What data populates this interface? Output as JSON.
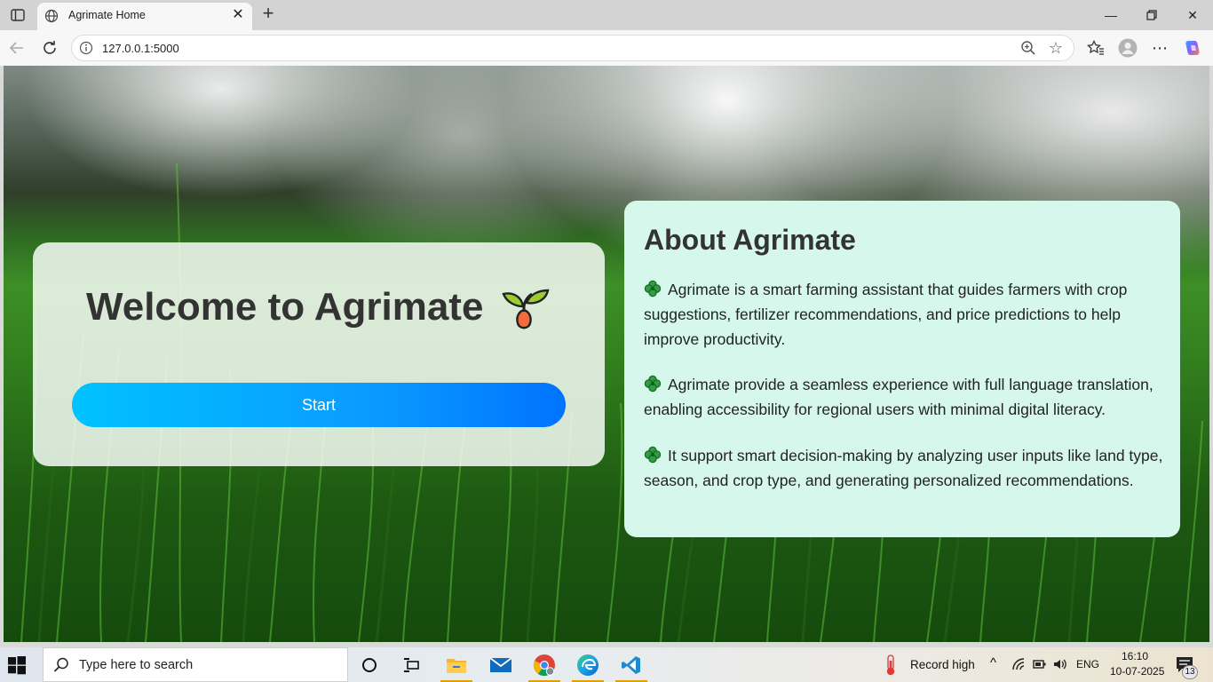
{
  "browser": {
    "tab_title": "Agrimate Home",
    "url": "127.0.0.1:5000"
  },
  "page": {
    "welcome_title": "Welcome to Agrimate",
    "start_label": "Start",
    "about_title": "About Agrimate",
    "about_paragraphs": [
      "Agrimate is a smart farming assistant that guides farmers with crop suggestions, fertilizer recommendations, and price predictions to help improve productivity.",
      "Agrimate provide a seamless experience with full language translation, enabling accessibility for regional users with minimal digital literacy.",
      "It support smart decision-making by analyzing user inputs like land type, season, and crop type, and generating personalized recommendations."
    ],
    "colors": {
      "about_bg": "#d6f8ec",
      "button_start": "#00c2ff",
      "button_end": "#0073ff",
      "title_text": "#333333"
    }
  },
  "taskbar": {
    "search_placeholder": "Type here to search",
    "weather": "Record high",
    "language": "ENG",
    "time": "16:10",
    "date": "10-07-2025",
    "notification_count": "13",
    "apps": [
      "task-view",
      "file-explorer",
      "mail",
      "chrome",
      "edge",
      "vscode"
    ]
  }
}
